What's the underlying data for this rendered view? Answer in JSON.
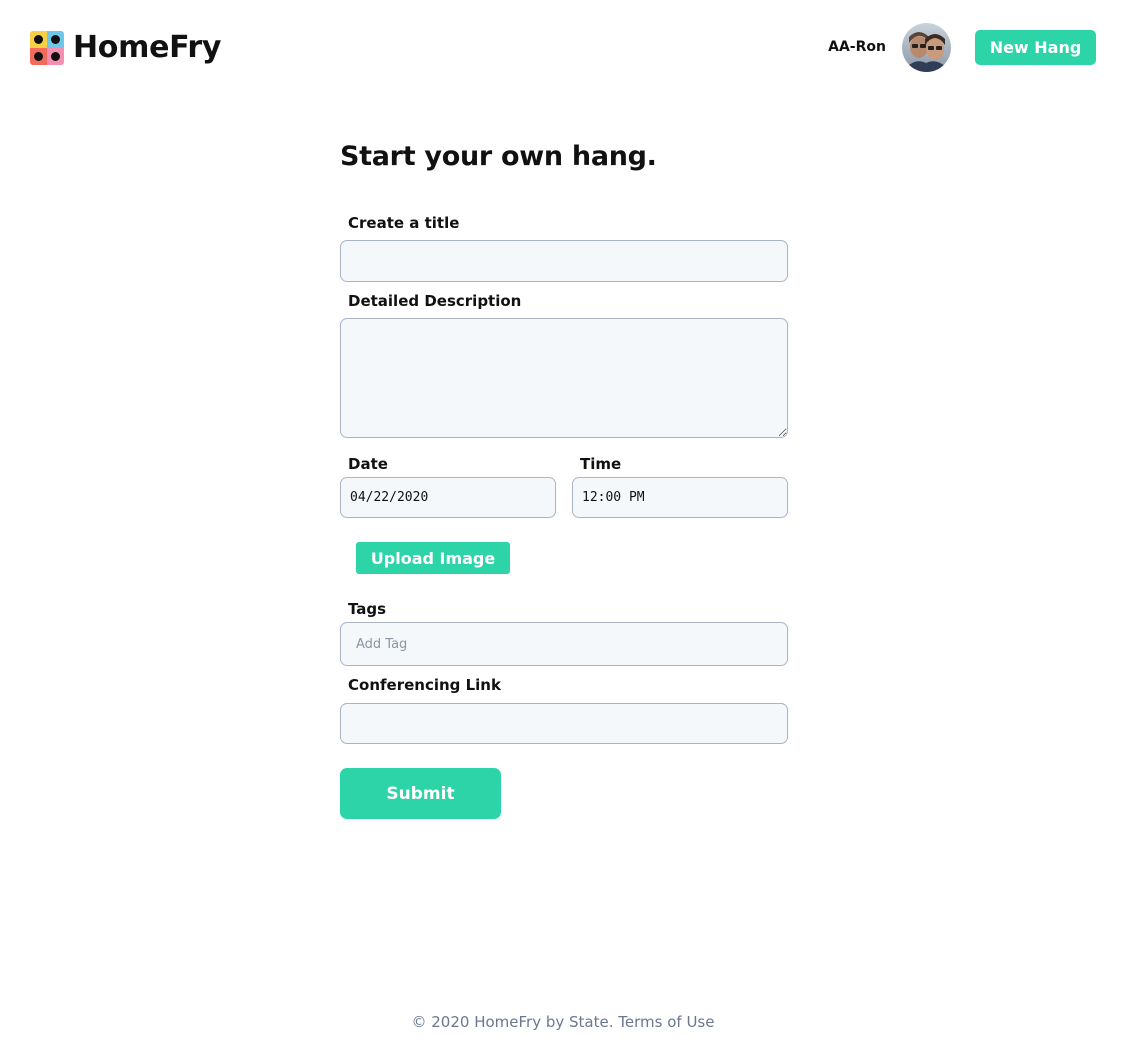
{
  "app": {
    "brand": "HomeFry"
  },
  "header": {
    "username": "AA-Ron",
    "new_hang_label": "New Hang"
  },
  "colors": {
    "accent": "#2dd4a7",
    "logo_yellow": "#f7d046",
    "logo_blue": "#6ec6e8",
    "logo_red": "#f26b5b",
    "logo_pink": "#f48fb1"
  },
  "icons": {
    "logo": "four-dot-grid-logo",
    "avatar": "user-avatar-photo"
  },
  "form": {
    "title": "Start your own hang.",
    "title_label": "Create a title",
    "title_value": "",
    "description_label": "Detailed Description",
    "description_value": "",
    "date_label": "Date",
    "date_value": "04/22/2020",
    "time_label": "Time",
    "time_value": "12:00 PM",
    "upload_label": "Upload Image",
    "tags_label": "Tags",
    "tags_placeholder": "Add Tag",
    "link_label": "Conferencing Link",
    "link_value": "",
    "submit_label": "Submit"
  },
  "footer": {
    "copyright": "© 2020 HomeFry by State.",
    "terms_label": "Terms of Use"
  }
}
